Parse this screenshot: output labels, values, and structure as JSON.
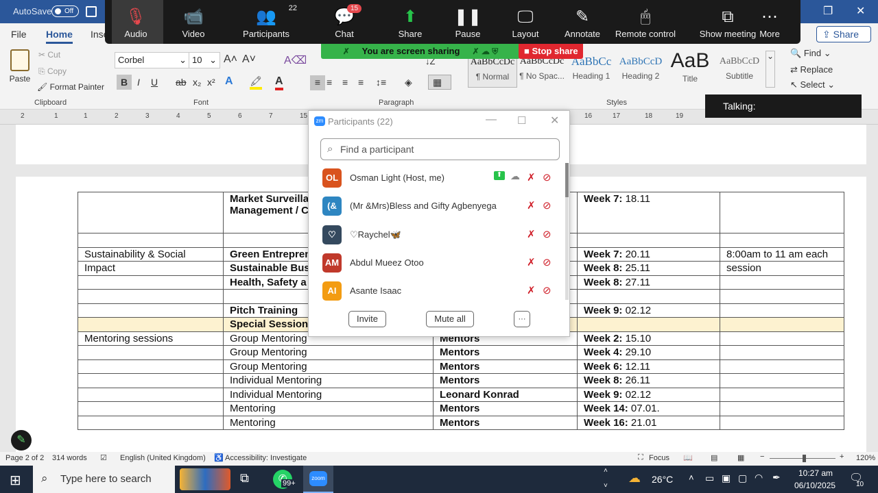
{
  "titlebar": {
    "autosave_label": "AutoSave",
    "autosave_state": "Off"
  },
  "ribbon": {
    "tabs": [
      "File",
      "Home",
      "Inse"
    ],
    "clipboard": {
      "paste": "Paste",
      "cut": "Cut",
      "copy": "Copy",
      "format_painter": "Format Painter",
      "label": "Clipboard"
    },
    "font": {
      "name": "Corbel",
      "size": "10",
      "label": "Font"
    },
    "paragraph_label": "Paragraph",
    "styles": [
      {
        "preview": "AaBbCcDc",
        "name": "¶ Normal"
      },
      {
        "preview": "AaBbCcDc",
        "name": "¶ No Spac..."
      },
      {
        "preview": "AaBbCc",
        "name": "Heading 1"
      },
      {
        "preview": "AaBbCcD",
        "name": "Heading 2"
      },
      {
        "preview": "AaB",
        "name": "Title"
      },
      {
        "preview": "AaBbCcD",
        "name": "Subtitle"
      }
    ],
    "styles_label": "Styles",
    "editing": {
      "find": "Find",
      "replace": "Replace",
      "select": "Select"
    },
    "share": "Share"
  },
  "ruler": [
    "2",
    "1",
    "1",
    "2",
    "3",
    "4",
    "5",
    "6",
    "7",
    "15",
    "16",
    "17",
    "18",
    "19",
    "20",
    "21",
    "22",
    "23"
  ],
  "zoom_toolbar": {
    "items": [
      {
        "label": "Audio",
        "icon": "mic-off-icon"
      },
      {
        "label": "Video",
        "icon": "video-off-icon"
      },
      {
        "label": "Participants",
        "icon": "participants-icon",
        "count": "22"
      },
      {
        "label": "Chat",
        "icon": "chat-icon",
        "badge": "15"
      },
      {
        "label": "Share",
        "icon": "share-icon"
      },
      {
        "label": "Pause",
        "icon": "pause-icon"
      },
      {
        "label": "Layout",
        "icon": "layout-icon"
      },
      {
        "label": "Annotate",
        "icon": "annotate-icon"
      },
      {
        "label": "Remote control",
        "icon": "remote-control-icon"
      },
      {
        "label": "Show meeting",
        "icon": "show-meeting-icon"
      },
      {
        "label": "More",
        "icon": "more-icon"
      }
    ],
    "sharing_banner": "You are screen sharing",
    "stop_share": "Stop share",
    "talking": "Talking:"
  },
  "participants_panel": {
    "title": "Participants (22)",
    "search_placeholder": "Find a participant",
    "participants": [
      {
        "initials": "OL",
        "name": "Osman Light (Host, me)",
        "color": "#d9531e"
      },
      {
        "initials": "(&",
        "name": "(Mr &Mrs)Bless and Gifty Agbenyega",
        "color": "#2e86c1"
      },
      {
        "initials": "♡",
        "name": "♡Raychel🦋",
        "color": "#34495e"
      },
      {
        "initials": "AM",
        "name": "Abdul Mueez Otoo",
        "color": "#c0392b"
      },
      {
        "initials": "AI",
        "name": "Asante Isaac",
        "color": "#f39c12"
      }
    ],
    "invite": "Invite",
    "mute_all": "Mute all",
    "more": "···"
  },
  "document": {
    "rows": [
      {
        "c1": "",
        "c2": "Market Surveilla",
        "c2b": "Management / C",
        "c3": "",
        "c4": "Week 7:",
        "c4v": " 18.11",
        "c5": ""
      },
      {
        "c1": "",
        "c2": "",
        "c3": "",
        "c4": "",
        "c4v": "",
        "c5": ""
      },
      {
        "c1": "Sustainability & Social",
        "c2": "Green Entrepren",
        "c3": "",
        "c4": "Week 7:",
        "c4v": " 20.11",
        "c5": "8:00am to 11 am each"
      },
      {
        "c1": "Impact",
        "c2": "Sustainable Busi",
        "c3": "",
        "c4": "Week 8:",
        "c4v": " 25.11",
        "c5": "session"
      },
      {
        "c1": "",
        "c2": "Health, Safety a",
        "c3": "",
        "c4": "Week 8:",
        "c4v": " 27.11",
        "c5": ""
      },
      {
        "c1": "",
        "c2": "",
        "c3": "",
        "c4": "",
        "c4v": "",
        "c5": ""
      },
      {
        "c1": "",
        "c2": "Pitch Training",
        "c3": "",
        "c4": "Week 9:",
        "c4v": " 02.12",
        "c5": ""
      },
      {
        "c1": "",
        "c2": "Special Sessions",
        "c3": "",
        "c4": "",
        "c4v": "",
        "c5": ""
      },
      {
        "c1": "Mentoring sessions",
        "c2": "Group Mentoring",
        "c3": "Mentors",
        "c4": "Week 2:",
        "c4v": " 15.10",
        "c5": ""
      },
      {
        "c1": "",
        "c2": "Group Mentoring",
        "c3": "Mentors",
        "c4": "Week 4:",
        "c4v": " 29.10",
        "c5": ""
      },
      {
        "c1": "",
        "c2": "Group Mentoring",
        "c3": "Mentors",
        "c4": "Week 6:",
        "c4v": " 12.11",
        "c5": ""
      },
      {
        "c1": "",
        "c2": "Individual Mentoring",
        "c3": "Mentors",
        "c4": "Week 8:",
        "c4v": " 26.11",
        "c5": ""
      },
      {
        "c1": "",
        "c2": "Individual Mentoring",
        "c3": "Leonard Konrad",
        "c4": "Week 9:",
        "c4v": " 02.12",
        "c5": ""
      },
      {
        "c1": "",
        "c2": "Mentoring",
        "c3": "Mentors",
        "c4": "Week 14:",
        "c4v": " 07.01.",
        "c5": ""
      },
      {
        "c1": "",
        "c2": "Mentoring",
        "c3": "Mentors",
        "c4": "Week 16:",
        "c4v": " 21.01",
        "c5": ""
      }
    ]
  },
  "statusbar": {
    "page": "Page 2 of 2",
    "words": "314 words",
    "language": "English (United Kingdom)",
    "accessibility": "Accessibility: Investigate",
    "focus": "Focus",
    "zoom": "120%"
  },
  "taskbar": {
    "search_placeholder": "Type here to search",
    "whatsapp_badge": "99+",
    "zoom_app": "zoom",
    "weather": "26°C",
    "time": "10:27 am",
    "date": "06/10/2025",
    "notifications": "10"
  }
}
